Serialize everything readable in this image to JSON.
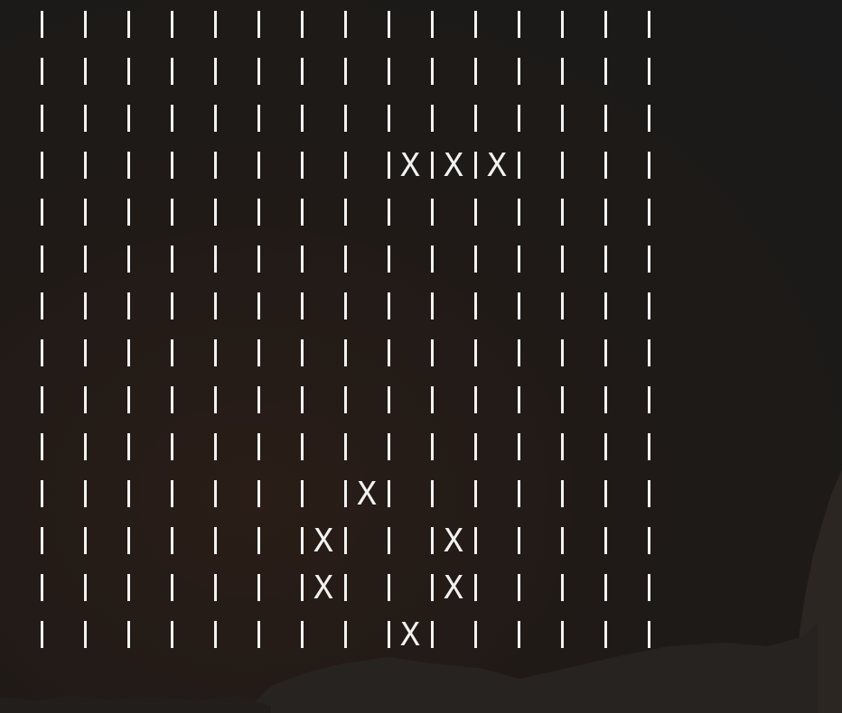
{
  "board": {
    "rows": 14,
    "cols": 14,
    "empty_symbol": "",
    "marker_symbol": "X",
    "cells": [
      [
        "",
        "",
        "",
        "",
        "",
        "",
        "",
        "",
        "",
        "",
        "",
        "",
        "",
        ""
      ],
      [
        "",
        "",
        "",
        "",
        "",
        "",
        "",
        "",
        "",
        "",
        "",
        "",
        "",
        ""
      ],
      [
        "",
        "",
        "",
        "",
        "",
        "",
        "",
        "",
        "",
        "",
        "",
        "",
        "",
        ""
      ],
      [
        "",
        "",
        "",
        "",
        "",
        "",
        "",
        "",
        "X",
        "X",
        "X",
        "",
        "",
        ""
      ],
      [
        "",
        "",
        "",
        "",
        "",
        "",
        "",
        "",
        "",
        "",
        "",
        "",
        "",
        ""
      ],
      [
        "",
        "",
        "",
        "",
        "",
        "",
        "",
        "",
        "",
        "",
        "",
        "",
        "",
        ""
      ],
      [
        "",
        "",
        "",
        "",
        "",
        "",
        "",
        "",
        "",
        "",
        "",
        "",
        "",
        ""
      ],
      [
        "",
        "",
        "",
        "",
        "",
        "",
        "",
        "",
        "",
        "",
        "",
        "",
        "",
        ""
      ],
      [
        "",
        "",
        "",
        "",
        "",
        "",
        "",
        "",
        "",
        "",
        "",
        "",
        "",
        ""
      ],
      [
        "",
        "",
        "",
        "",
        "",
        "",
        "",
        "",
        "",
        "",
        "",
        "",
        "",
        ""
      ],
      [
        "",
        "",
        "",
        "",
        "",
        "",
        "",
        "X",
        "",
        "",
        "",
        "",
        "",
        ""
      ],
      [
        "",
        "",
        "",
        "",
        "",
        "",
        "X",
        "",
        "",
        "X",
        "",
        "",
        "",
        ""
      ],
      [
        "",
        "",
        "",
        "",
        "",
        "",
        "X",
        "",
        "",
        "X",
        "",
        "",
        "",
        ""
      ],
      [
        "",
        "",
        "",
        "",
        "",
        "",
        "",
        "",
        "X",
        "",
        "",
        "",
        "",
        ""
      ]
    ]
  },
  "colors": {
    "glyph": "#f2f2f2",
    "background": "#1f1a17",
    "terrain": "#2b2622"
  },
  "background_scene": {
    "description_icon": "night-mountain-silhouette"
  }
}
